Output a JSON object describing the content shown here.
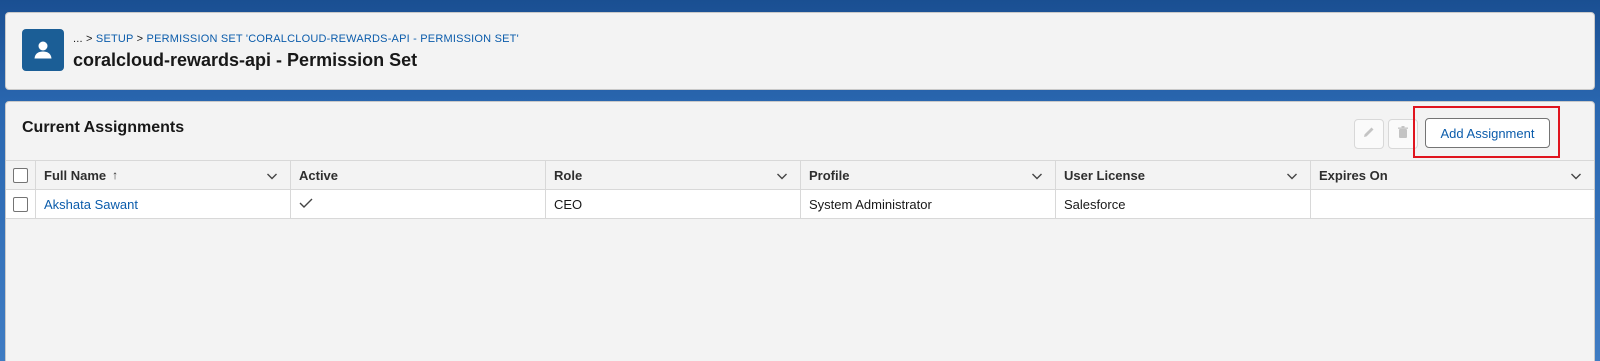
{
  "header": {
    "breadcrumb_prefix": "... > ",
    "breadcrumb_setup": "SETUP",
    "breadcrumb_sep": " > ",
    "breadcrumb_permset": "PERMISSION SET 'CORALCLOUD-REWARDS-API - PERMISSION SET'",
    "title": "coralcloud-rewards-api - Permission Set",
    "icon": "user-icon"
  },
  "assignments": {
    "title": "Current Assignments",
    "edit_icon": "pencil-icon",
    "delete_icon": "trash-icon",
    "add_button": "Add Assignment",
    "columns": [
      "Full Name",
      "Active",
      "Role",
      "Profile",
      "User License",
      "Expires On"
    ],
    "sort_indicator": "↑",
    "rows": [
      {
        "full_name": "Akshata Sawant",
        "active": true,
        "role": "CEO",
        "profile": "System Administrator",
        "user_license": "Salesforce",
        "expires_on": ""
      }
    ]
  },
  "colors": {
    "brand_blue": "#1b5e96",
    "link": "#0b5cab",
    "highlight": "#e0141e"
  }
}
